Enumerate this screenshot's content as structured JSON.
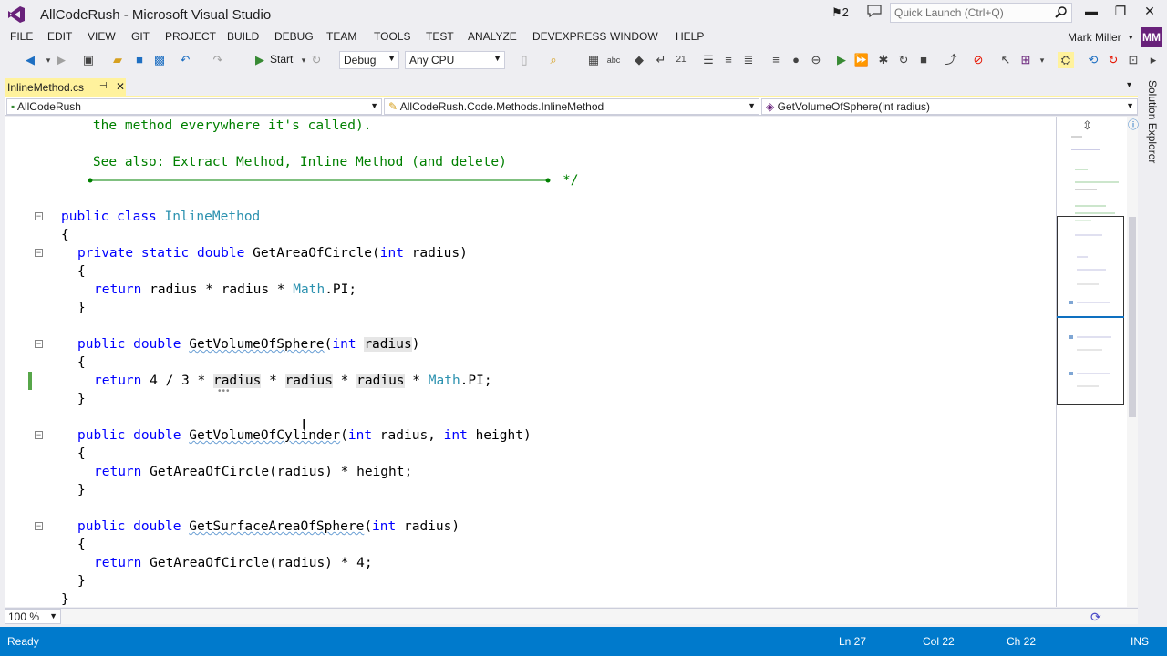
{
  "window": {
    "title": "AllCodeRush - Microsoft Visual Studio",
    "notification_count": "2",
    "quick_launch_placeholder": "Quick Launch (Ctrl+Q)"
  },
  "menu": [
    "FILE",
    "EDIT",
    "VIEW",
    "GIT",
    "PROJECT",
    "BUILD",
    "DEBUG",
    "TEAM",
    "TOOLS",
    "TEST",
    "ANALYZE",
    "DEVEXPRESS",
    "WINDOW",
    "HELP"
  ],
  "user": {
    "name": "Mark Miller",
    "initials": "MM"
  },
  "toolbar": {
    "start_label": "Start",
    "config": "Debug",
    "platform": "Any CPU"
  },
  "doc_tab": {
    "label": "InlineMethod.cs"
  },
  "navbar": {
    "project": "AllCodeRush",
    "type": "AllCodeRush.Code.Methods.InlineMethod",
    "member": "GetVolumeOfSphere(int radius)"
  },
  "side_panel": {
    "label": "Solution Explorer"
  },
  "code": {
    "comment1": "    the method everywhere it's called).",
    "comment2": "    See also: Extract Method, Inline Method (and delete)",
    "comment_end": "*/"
  },
  "zoom": "100 %",
  "status": {
    "ready": "Ready",
    "ln": "Ln 27",
    "col": "Col 22",
    "ch": "Ch 22",
    "mode": "INS"
  },
  "colors": {
    "accent": "#007acc",
    "tab_active": "#fff29d",
    "keyword": "#0000ff",
    "type": "#2b91af",
    "comment": "#008000"
  }
}
